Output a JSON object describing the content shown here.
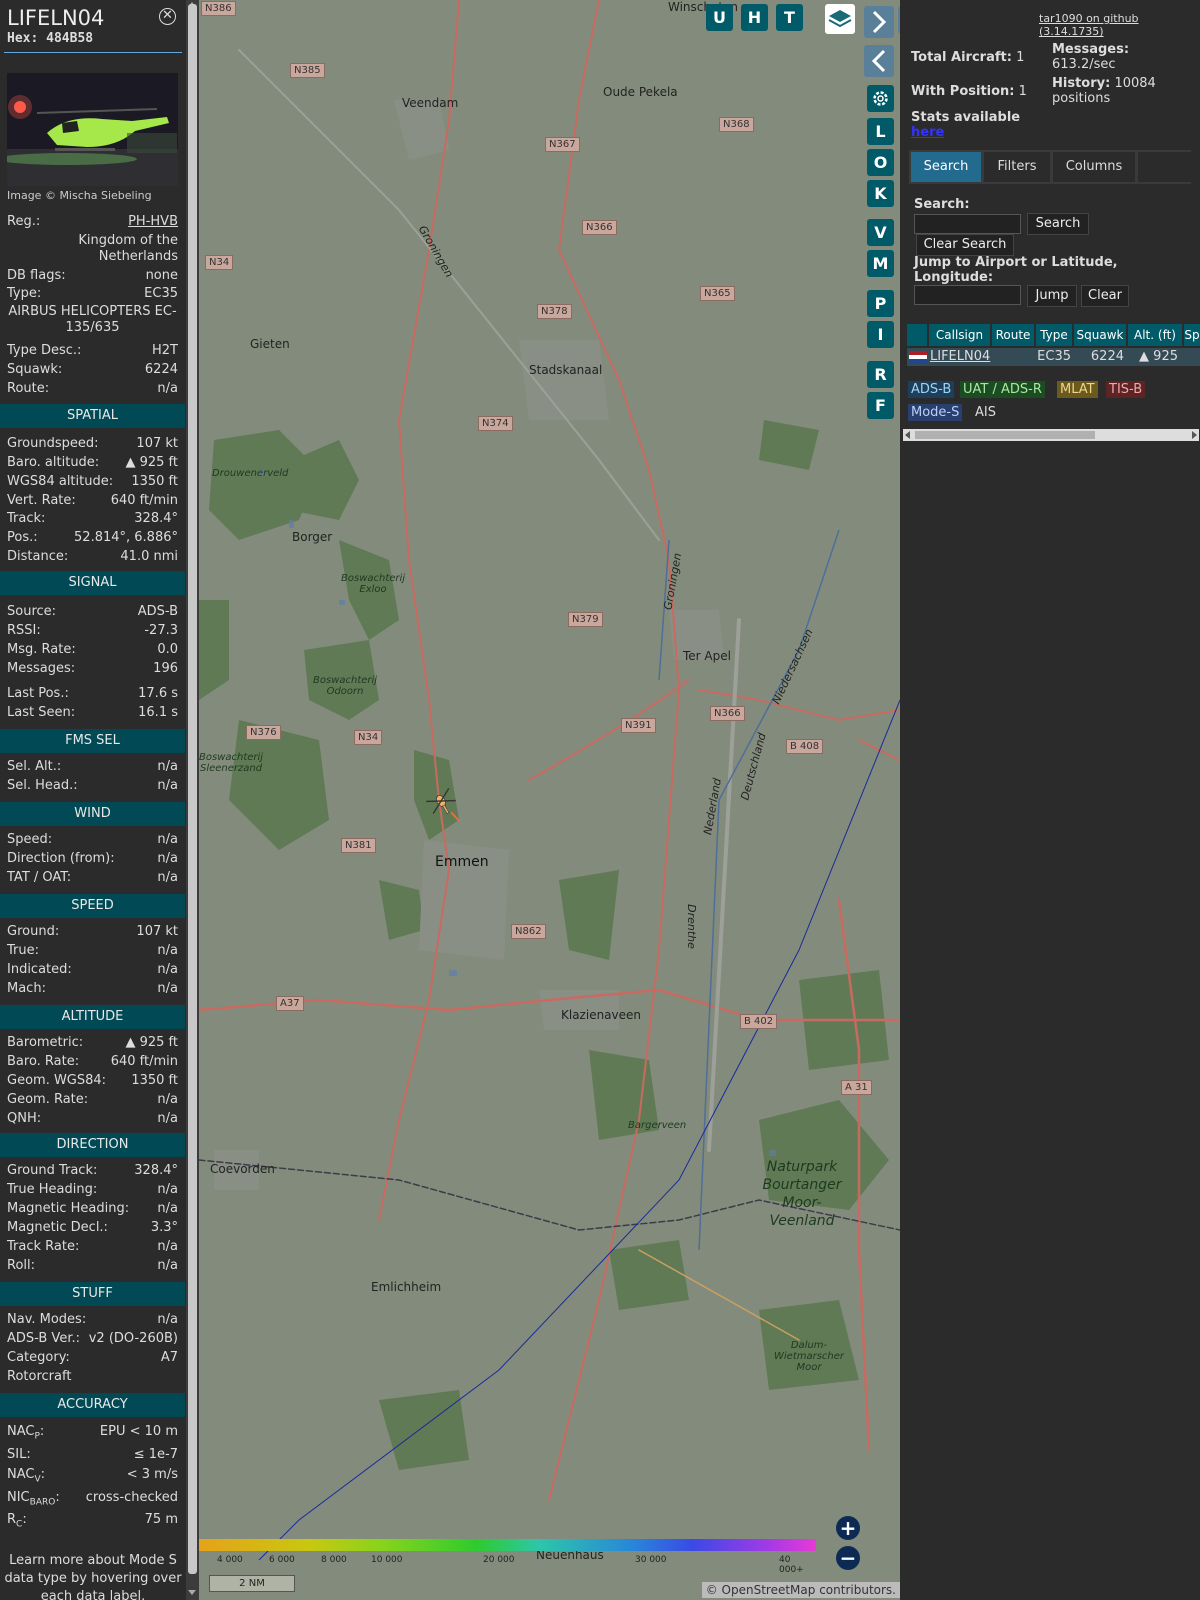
{
  "info": {
    "callsign": "LIFELN04",
    "hex_label": "Hex:",
    "hex": "484B58",
    "image_credit": "Image © Mischa Siebeling",
    "reg_label": "Reg.:",
    "reg": "PH-HVB",
    "country_line1": "Kingdom of the",
    "country_line2": "Netherlands",
    "dbflags_label": "DB flags:",
    "dbflags": "none",
    "type_label": "Type:",
    "type": "EC35",
    "type_full_line1": "AIRBUS HELICOPTERS EC-",
    "type_full_line2": "135/635",
    "typedesc_label": "Type Desc.:",
    "typedesc": "H2T",
    "squawk_label": "Squawk:",
    "squawk": "6224",
    "route_label": "Route:",
    "route": "n/a"
  },
  "sections": {
    "spatial": "SPATIAL",
    "signal": "SIGNAL",
    "fms": "FMS SEL",
    "wind": "WIND",
    "speed": "SPEED",
    "altitude": "ALTITUDE",
    "direction": "DIRECTION",
    "stuff": "STUFF",
    "accuracy": "ACCURACY"
  },
  "spatial": [
    {
      "k": "Groundspeed:",
      "v": "107 kt"
    },
    {
      "k": "Baro. altitude:",
      "v": "▲ 925 ft"
    },
    {
      "k": "WGS84 altitude:",
      "v": "1350 ft"
    },
    {
      "k": "Vert. Rate:",
      "v": "640 ft/min"
    },
    {
      "k": "Track:",
      "v": "328.4°"
    },
    {
      "k": "Pos.:",
      "v": "52.814°, 6.886°"
    },
    {
      "k": "Distance:",
      "v": "41.0 nmi"
    }
  ],
  "signal": [
    {
      "k": "Source:",
      "v": "ADS-B"
    },
    {
      "k": "RSSI:",
      "v": "-27.3"
    },
    {
      "k": "Msg. Rate:",
      "v": "0.0"
    },
    {
      "k": "Messages:",
      "v": "196"
    },
    {
      "k": "Last Pos.:",
      "v": "17.6 s"
    },
    {
      "k": "Last Seen:",
      "v": "16.1 s"
    }
  ],
  "fms": [
    {
      "k": "Sel. Alt.:",
      "v": "n/a"
    },
    {
      "k": "Sel. Head.:",
      "v": "n/a"
    }
  ],
  "wind": [
    {
      "k": "Speed:",
      "v": "n/a"
    },
    {
      "k": "Direction (from):",
      "v": "n/a"
    },
    {
      "k": "TAT / OAT:",
      "v": "n/a"
    }
  ],
  "speed": [
    {
      "k": "Ground:",
      "v": "107 kt"
    },
    {
      "k": "True:",
      "v": "n/a"
    },
    {
      "k": "Indicated:",
      "v": "n/a"
    },
    {
      "k": "Mach:",
      "v": "n/a"
    }
  ],
  "altitude": [
    {
      "k": "Barometric:",
      "v": "▲ 925 ft"
    },
    {
      "k": "Baro. Rate:",
      "v": "640 ft/min"
    },
    {
      "k": "Geom. WGS84:",
      "v": "1350 ft"
    },
    {
      "k": "Geom. Rate:",
      "v": "n/a"
    },
    {
      "k": "QNH:",
      "v": "n/a"
    }
  ],
  "direction": [
    {
      "k": "Ground Track:",
      "v": "328.4°"
    },
    {
      "k": "True Heading:",
      "v": "n/a"
    },
    {
      "k": "Magnetic Heading:",
      "v": "n/a"
    },
    {
      "k": "Magnetic Decl.:",
      "v": "3.3°"
    },
    {
      "k": "Track Rate:",
      "v": "n/a"
    },
    {
      "k": "Roll:",
      "v": "n/a"
    }
  ],
  "stuff": [
    {
      "k": "Nav. Modes:",
      "v": "n/a"
    },
    {
      "k": "ADS-B Ver.:",
      "v": "v2 (DO-260B)"
    },
    {
      "k": "Category:",
      "v": "A7"
    },
    {
      "k": "Rotorcraft",
      "v": ""
    }
  ],
  "accuracy": {
    "nacp_k": "NAC",
    "nacp_sub": "P",
    "nacp_v": "EPU < 10 m",
    "sil_k": "SIL:",
    "sil_v": "≤ 1e-7",
    "nacv_k": "NAC",
    "nacv_sub": "V",
    "nacv_v": "< 3 m/s",
    "nicbaro_k": "NIC",
    "nicbaro_sub": "BARO",
    "nicbaro_v": "cross-checked",
    "rc_k": "R",
    "rc_sub": "C",
    "rc_v": "75 m"
  },
  "footer_line1": "Learn more about Mode S",
  "footer_line2": "data type by hovering over",
  "footer_line3": "each data label.",
  "map": {
    "top_buttons": [
      "U",
      "H",
      "T"
    ],
    "side_buttons": [
      "L",
      "O",
      "K",
      "V",
      "M",
      "P",
      "I",
      "R",
      "F"
    ],
    "zoom_in": "+",
    "zoom_out": "−",
    "scale": "2 NM",
    "attribution_prefix": "© ",
    "attribution_link": "OpenStreetMap",
    "attribution_suffix": " contributors.",
    "altitude_ticks": [
      "4 000",
      "6 000",
      "8 000",
      "10 000",
      "20 000",
      "30 000",
      "40 000+"
    ],
    "towns": {
      "winschoten": "Winschoten",
      "veendam": "Veendam",
      "oude_pekela": "Oude Pekela",
      "gieten": "Gieten",
      "stadskanaal": "Stadskanaal",
      "borger": "Borger",
      "ter_apel": "Ter Apel",
      "emmen": "Emmen",
      "klazienaveen": "Klazienaveen",
      "coevorden": "Coevorden",
      "emlichheim": "Emlichheim",
      "neuenhaus": "Neuenhaus"
    },
    "roads": [
      "N386",
      "N385",
      "N367",
      "N368",
      "N366",
      "N365",
      "N34",
      "N378",
      "N374",
      "N379",
      "N366",
      "N391",
      "N376",
      "N34",
      "N381",
      "N862",
      "A37",
      "B 408",
      "B 402",
      "A 31"
    ],
    "nature": {
      "drouwenerveld": "Drouwenerveld",
      "exloo_1": "Boswachterij",
      "exloo_2": "Exloo",
      "odoorn_1": "Boswachterij",
      "odoorn_2": "Odoorn",
      "sleenerzand_1": "Boswachterij",
      "sleenerzand_2": "Sleenerzand",
      "bargerveen": "Bargerveen",
      "dalum_1": "Dalum-",
      "dalum_2": "Wietmarscher",
      "dalum_3": "Moor"
    },
    "park_lines": [
      "Naturpark",
      "Bourtanger",
      "Moor-",
      "Veenland"
    ],
    "water_labels": {
      "groningen": "Groningen",
      "nederland": "Nederland",
      "deutschland": "Deutschland",
      "niedersachsen": "Niedersachsen",
      "drenthe": "Drenthe"
    }
  },
  "side": {
    "github": "tar1090 on github (3.14.1735)",
    "total_label": "Total Aircraft:",
    "total": "1",
    "withpos_label": "With Position:",
    "withpos": "1",
    "messages_label": "Messages:",
    "messages": "613.2/sec",
    "history_label": "History:",
    "history_line1": "10084",
    "history_line2": "positions",
    "stats_text": "Stats available",
    "stats_link": "here",
    "tabs": [
      "Search",
      "Filters",
      "Columns"
    ],
    "search_label": "Search:",
    "search_button": "Search",
    "clear_search": "Clear Search",
    "jump_label_1": "Jump to Airport or Latitude,",
    "jump_label_2": "Longitude:",
    "jump_button": "Jump",
    "clear_button": "Clear",
    "columns": [
      "Callsign",
      "Route",
      "Type",
      "Squawk",
      "Alt. (ft)",
      "Sp"
    ],
    "row": {
      "callsign": "LIFELN04",
      "type": "EC35",
      "squawk": "6224",
      "alt": "▲ 925"
    },
    "badges": {
      "adsb": "ADS-B",
      "uat": "UAT / ADS-R",
      "mlat": "MLAT",
      "tisb": "TIS-B",
      "modes": "Mode-S",
      "ais": "AIS"
    }
  },
  "colors": {
    "section_bg": "#004955",
    "button_bg": "#005a67",
    "tab_active": "#226b8e",
    "badge_adsb": "#1e3f5c",
    "badge_uat": "#1c4d22",
    "badge_mlat": "#6b5a1d",
    "badge_tisb": "#5c2424",
    "badge_modes": "#283f70",
    "aircraft": "#f2b26a"
  }
}
